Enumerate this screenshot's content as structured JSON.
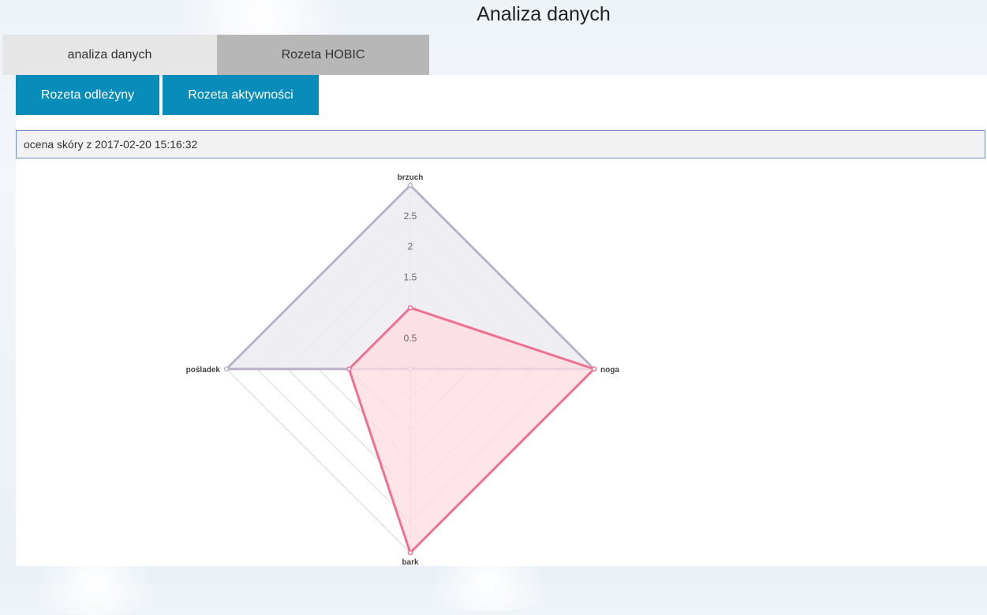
{
  "page": {
    "title": "Analiza danych"
  },
  "tabs": [
    {
      "label": "analiza danych",
      "active": true
    },
    {
      "label": "Rozeta HOBIC",
      "active": false
    }
  ],
  "buttons": {
    "rozeta_odlezyny": "Rozeta odleżyny",
    "rozeta_aktywnosci": "Rozeta aktywności"
  },
  "session": {
    "label": "ocena skóry z 2017-02-20 15:16:32"
  },
  "colors": {
    "button": "#088dbb",
    "series_a_line": "#b9b2c9",
    "series_a_fill": "#ecebf1",
    "series_b_line": "#f07090",
    "series_b_fill": "#ffdbe2"
  },
  "chart_data": {
    "type": "radar",
    "axes": [
      "brzuch",
      "noga",
      "bark",
      "pośladek"
    ],
    "ticks": [
      0.5,
      1,
      1.5,
      2,
      2.5,
      3
    ],
    "tick_labels_shown": [
      "0.5",
      "1.5",
      "2",
      "2.5"
    ],
    "rlim": [
      0,
      3
    ],
    "series": [
      {
        "values": [
          3,
          3,
          0,
          3
        ]
      },
      {
        "values": [
          1,
          3,
          3,
          1
        ]
      }
    ],
    "grid": true,
    "legend": "none"
  }
}
